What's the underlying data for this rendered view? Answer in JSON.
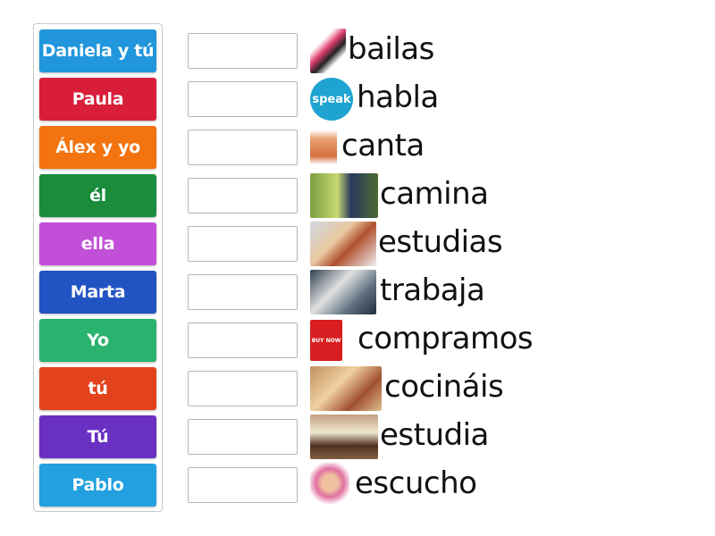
{
  "tiles": [
    {
      "label": "Daniela y tú",
      "color": "#2196dc"
    },
    {
      "label": "Paula",
      "color": "#d91e3a"
    },
    {
      "label": "Álex y yo",
      "color": "#f2730f"
    },
    {
      "label": "él",
      "color": "#1a8c3c"
    },
    {
      "label": "ella",
      "color": "#c24fd8"
    },
    {
      "label": "Marta",
      "color": "#2253c2"
    },
    {
      "label": "Yo",
      "color": "#2ab36e"
    },
    {
      "label": "tú",
      "color": "#e2431c"
    },
    {
      "label": "Tú",
      "color": "#6a30c2"
    },
    {
      "label": "Pablo",
      "color": "#22a0e0"
    }
  ],
  "targets": [
    {
      "word": "bailas",
      "image": "dancers-image"
    },
    {
      "word": "habla",
      "image": "speak-bubble-image",
      "image_text": "speak"
    },
    {
      "word": "canta",
      "image": "singing-girl-image"
    },
    {
      "word": "camina",
      "image": "walking-image"
    },
    {
      "word": "estudias",
      "image": "studying-boy-image"
    },
    {
      "word": "trabaja",
      "image": "workers-image"
    },
    {
      "word": "compramos",
      "image": "buy-now-cart-image",
      "image_text": "BUY NOW"
    },
    {
      "word": "cocináis",
      "image": "cooking-image"
    },
    {
      "word": "estudia",
      "image": "tired-student-image"
    },
    {
      "word": "escucho",
      "image": "listening-girl-image"
    }
  ]
}
